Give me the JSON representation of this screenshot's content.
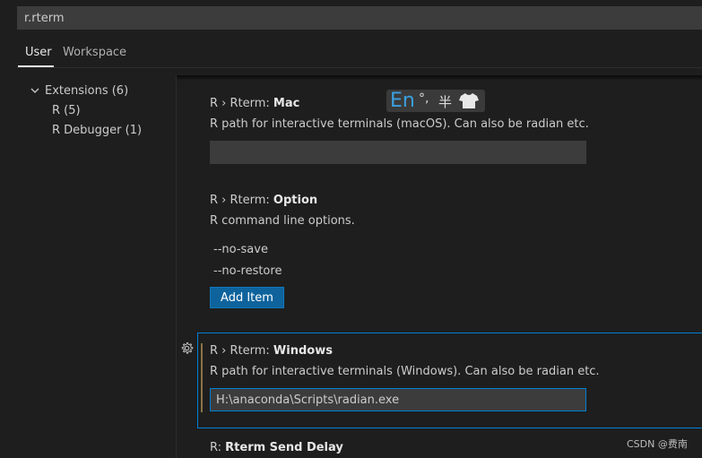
{
  "search": {
    "value": "r.rterm"
  },
  "tabs": [
    {
      "label": "User"
    },
    {
      "label": "Workspace"
    }
  ],
  "tree": {
    "items": [
      {
        "label": "Extensions (6)"
      },
      {
        "label": "R (5)"
      },
      {
        "label": "R Debugger (1)"
      }
    ]
  },
  "settings": {
    "mac": {
      "prefix": "R › Rterm: ",
      "name": "Mac",
      "description": "R path for interactive terminals (macOS). Can also be radian etc.",
      "value": ""
    },
    "option": {
      "prefix": "R › Rterm: ",
      "name": "Option",
      "description": "R command line options.",
      "items": [
        "--no-save",
        "--no-restore"
      ],
      "add_label": "Add Item"
    },
    "windows": {
      "prefix": "R › Rterm: ",
      "name": "Windows",
      "description": "R path for interactive terminals (Windows). Can also be radian etc.",
      "value": "H:\\anaconda\\Scripts\\radian.exe"
    },
    "send_delay": {
      "prefix": "R: ",
      "name": "Rterm Send Delay"
    }
  },
  "ime": {
    "lang": "En",
    "punct": "°,",
    "width": "半"
  },
  "watermark": "CSDN @费南",
  "colors": {
    "accent": "#007fd4",
    "button": "#0e639c",
    "modified": "#8a7443",
    "background": "#1e1e1e"
  },
  "icons": [
    "chevron-down-icon",
    "gear-icon",
    "tshirt-skin-icon"
  ]
}
